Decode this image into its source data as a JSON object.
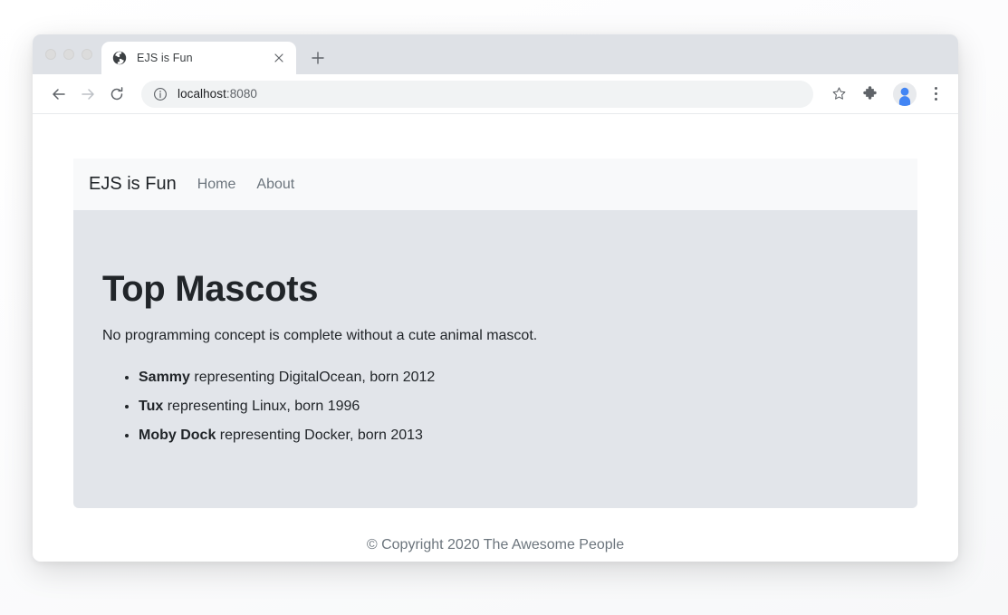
{
  "browser": {
    "traffic_lights": [
      "close",
      "minimize",
      "maximize"
    ],
    "tab": {
      "title": "EJS is Fun",
      "favicon": "globe-icon",
      "close": "close-icon"
    },
    "new_tab_label": "+",
    "toolbar": {
      "back": "back-arrow-icon",
      "forward": "forward-arrow-icon",
      "reload": "reload-icon",
      "site_info": "info-icon",
      "url_primary": "localhost",
      "url_secondary": ":8080",
      "bookmark": "star-icon",
      "extensions": "puzzle-piece-icon",
      "profile": "avatar-icon",
      "menu": "three-dot-menu-icon"
    }
  },
  "page": {
    "navbar": {
      "brand": "EJS is Fun",
      "links": [
        {
          "label": "Home"
        },
        {
          "label": "About"
        }
      ]
    },
    "jumbotron": {
      "title": "Top Mascots",
      "lead": "No programming concept is complete without a cute animal mascot.",
      "mascots": [
        {
          "name": "Sammy",
          "detail": " representing DigitalOcean, born 2012"
        },
        {
          "name": "Tux",
          "detail": " representing Linux, born 1996"
        },
        {
          "name": "Moby Dock",
          "detail": " representing Docker, born 2013"
        }
      ]
    },
    "footer": {
      "text": "© Copyright 2020 The Awesome People"
    }
  },
  "colors": {
    "navbar_bg": "#f8f9fa",
    "jumbotron_bg": "#e2e5ea",
    "text_dark": "#212529",
    "text_muted": "#6c757d",
    "browser_tabstrip": "#dee1e6",
    "profile_accent": "#4285f4"
  }
}
